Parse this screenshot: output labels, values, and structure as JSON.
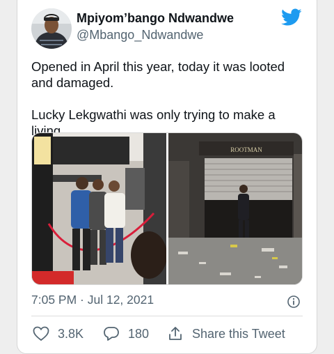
{
  "user": {
    "display_name": "Mpiyom’bango Ndwandwe",
    "handle": "@Mbango_Ndwandwe",
    "avatar_icon": "profile-photo"
  },
  "tweet": {
    "paragraphs": [
      "Opened in April this year, today it was looted and damaged.",
      "Lucky Lekgwathi was only trying to make a living."
    ],
    "sign_text": "ROOTMAN"
  },
  "meta": {
    "timestamp": "7:05 PM · Jul 12, 2021"
  },
  "actions": {
    "likes": "3.8K",
    "replies": "180",
    "share_label": "Share this Tweet"
  },
  "colors": {
    "brand": "#1d9bf0",
    "secondary_text": "#536471",
    "primary_text": "#0f1419"
  },
  "icons": [
    "twitter-bird-icon",
    "info-icon",
    "heart-icon",
    "reply-bubble-icon",
    "share-icon"
  ]
}
